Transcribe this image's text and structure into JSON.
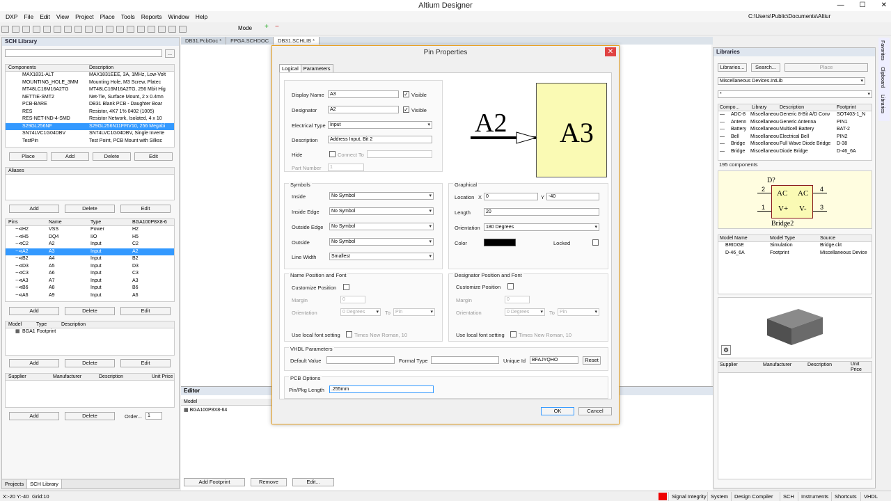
{
  "app": {
    "title": "Altium Designer"
  },
  "menu": [
    "DXP",
    "File",
    "Edit",
    "View",
    "Project",
    "Place",
    "Tools",
    "Reports",
    "Window",
    "Help"
  ],
  "toolbar": {
    "mode": "Mode",
    "path": "C:\\Users\\Public\\Documents\\Altiur"
  },
  "left": {
    "title": "SCH Library",
    "comp_headers": [
      "Components",
      "Description"
    ],
    "components": [
      [
        "MAX1831-ALT",
        "MAX1831EEE, 3A, 1MHz, Low-Volt"
      ],
      [
        "MOUNTING_HOLE_3MM",
        "Mounting Hole, M3 Screw, Platec"
      ],
      [
        "MT48LC16M16A2TG",
        "MT48LC16M16A2TG, 256 Mbit Hig"
      ],
      [
        "NETTIE-SMT2",
        "Net-Tie, Surface Mount, 2 x 0.4mn"
      ],
      [
        "PCB-BARE",
        "DB31 Blank PCB - Daughter Boar"
      ],
      [
        "RES",
        "Resistor, 4K7 1% 0402 (1005)"
      ],
      [
        "RES-NET-IND-4-SMD",
        "Resistor Network, Isolated, 4 x 10"
      ],
      [
        "S29GL256NF",
        "S29GL256N11FFIV10, 256 Megabi"
      ],
      [
        "SN74LVC1G04DBV",
        "SN74LVC1G04DBV, Single Inverte"
      ],
      [
        "TestPin",
        "Test Point, PCB Mount with Silksc"
      ]
    ],
    "comp_buttons": [
      "Place",
      "Add",
      "Delete",
      "Edit"
    ],
    "aliases_title": "Aliases",
    "alias_buttons": [
      "Add",
      "Delete",
      "Edit"
    ],
    "pin_headers": [
      "Pins",
      "Name",
      "Type",
      "BGA100P8X8-6"
    ],
    "pins": [
      [
        "H2",
        "VSS",
        "Power",
        "H2"
      ],
      [
        "H5",
        "DQ4",
        "I/O",
        "H5"
      ],
      [
        "C2",
        "A2",
        "Input",
        "C2"
      ],
      [
        "A2",
        "A3",
        "Input",
        "A2"
      ],
      [
        "B2",
        "A4",
        "Input",
        "B2"
      ],
      [
        "D3",
        "A5",
        "Input",
        "D3"
      ],
      [
        "C3",
        "A6",
        "Input",
        "C3"
      ],
      [
        "A3",
        "A7",
        "Input",
        "A3"
      ],
      [
        "B6",
        "A8",
        "Input",
        "B6"
      ],
      [
        "A6",
        "A9",
        "Input",
        "A6"
      ]
    ],
    "pin_buttons": [
      "Add",
      "Delete",
      "Edit"
    ],
    "model_headers": [
      "Model",
      "Type",
      "Description"
    ],
    "model_item": "BGA1 Footprint",
    "model_buttons": [
      "Add",
      "Delete",
      "Edit"
    ],
    "supplier_headers": [
      "Supplier",
      "Manufacturer",
      "Description",
      "Unit Price"
    ],
    "supplier_buttons": [
      "Add",
      "Delete"
    ],
    "order_label": "Order...",
    "order_value": "1",
    "bottom_tabs": [
      "Projects",
      "SCH Library"
    ]
  },
  "doc_tabs": [
    "DB31.PcbDoc *",
    "FPGA.SCHDOC",
    "DB31.SCHLIB *"
  ],
  "editor": {
    "label": "Editor",
    "model_header": "Model",
    "model_item": "BGA100P8X8-64",
    "buttons": [
      "Add Footprint",
      "Remove",
      "Edit..."
    ]
  },
  "dialog": {
    "title": "Pin Properties",
    "tabs": [
      "Logical",
      "Parameters"
    ],
    "display_name_label": "Display Name",
    "display_name": "A3",
    "visible_label": "Visible",
    "designator_label": "Designator",
    "designator": "A2",
    "electrical_type_label": "Electrical Type",
    "electrical_type": "Input",
    "description_label": "Description",
    "description": "Address Input, Bit 2",
    "hide_label": "Hide",
    "connect_to_label": "Connect To",
    "part_number_label": "Part Number",
    "part_number": "1",
    "preview_designator": "A2",
    "preview_name": "A3",
    "symbols_title": "Symbols",
    "inside_label": "Inside",
    "inside": "No Symbol",
    "inside_edge_label": "Inside Edge",
    "inside_edge": "No Symbol",
    "outside_edge_label": "Outside Edge",
    "outside_edge": "No Symbol",
    "outside_label": "Outside",
    "outside": "No Symbol",
    "line_width_label": "Line Width",
    "line_width": "Smallest",
    "graphical_title": "Graphical",
    "location_label": "Location",
    "x_label": "X",
    "x": "0",
    "y_label": "Y",
    "y": "-40",
    "length_label": "Length",
    "length": "20",
    "orientation_label": "Orientation",
    "orientation": "180 Degrees",
    "color_label": "Color",
    "color": "#000000",
    "locked_label": "Locked",
    "name_pos_title": "Name Position and Font",
    "desig_pos_title": "Designator Position and Font",
    "customize_label": "Customize Position",
    "margin_label": "Margin",
    "margin": "0",
    "orient_label": "Orientation",
    "orient_value": "0 Degrees",
    "to_label": "To",
    "to_value": "Pin",
    "local_font_label": "Use local font setting",
    "font_value": "Times New Roman, 10",
    "vhdl_title": "VHDL Parameters",
    "default_value_label": "Default Value",
    "formal_type_label": "Formal Type",
    "unique_id_label": "Unique Id",
    "unique_id": "BFAJYQHO",
    "reset_label": "Reset",
    "pcb_title": "PCB Options",
    "pkg_length_label": "Pin/Pkg Length",
    "pkg_length": ".255mm",
    "ok": "OK",
    "cancel": "Cancel"
  },
  "right": {
    "title": "Libraries",
    "buttons": [
      "Libraries...",
      "Search...",
      "Place"
    ],
    "library": "Miscellaneous Devices.IntLib",
    "filter": "*",
    "headers": [
      "Compo...",
      "Library",
      "Description",
      "Footprint"
    ],
    "rows": [
      [
        "ADC-8",
        "Miscellaneou",
        "Generic 8-Bit A/D Conv",
        "SOT403-1_N"
      ],
      [
        "Antenn",
        "Miscellaneou",
        "Generic Antenna",
        "PIN1"
      ],
      [
        "Battery",
        "Miscellaneou",
        "Multicell Battery",
        "BAT-2"
      ],
      [
        "Bell",
        "Miscellaneou",
        "Electrical Bell",
        "PIN2"
      ],
      [
        "Bridge",
        "Miscellaneou",
        "Full Wave Diode Bridge",
        "D-38"
      ],
      [
        "Bridge",
        "Miscellaneou",
        "Diode Bridge",
        "D-46_6A"
      ]
    ],
    "count": "195 components",
    "sym_designator": "D?",
    "sym_name": "Bridge2",
    "sym_pins": [
      "AC",
      "AC",
      "V+",
      "V-"
    ],
    "sym_pin_nums": [
      "2",
      "4",
      "1",
      "3"
    ],
    "model_headers": [
      "Model Name",
      "Model Type",
      "Source"
    ],
    "models": [
      [
        "BRIDGE",
        "Simulation",
        "Bridge.ckt"
      ],
      [
        "D-46_6A",
        "Footprint",
        "Miscellaneous Device"
      ]
    ],
    "supplier_headers": [
      "Supplier",
      "Manufacturer",
      "Description",
      "Unit Price"
    ]
  },
  "side_tabs": [
    "Favorites",
    "Clipboard",
    "Libraries"
  ],
  "status": {
    "coords": "X:-20 Y:-40",
    "grid": "Grid:10",
    "items": [
      "Signal Integrity",
      "System",
      "Design Compiler",
      "SCH",
      "Instruments",
      "Shortcuts",
      "VHDL"
    ]
  }
}
